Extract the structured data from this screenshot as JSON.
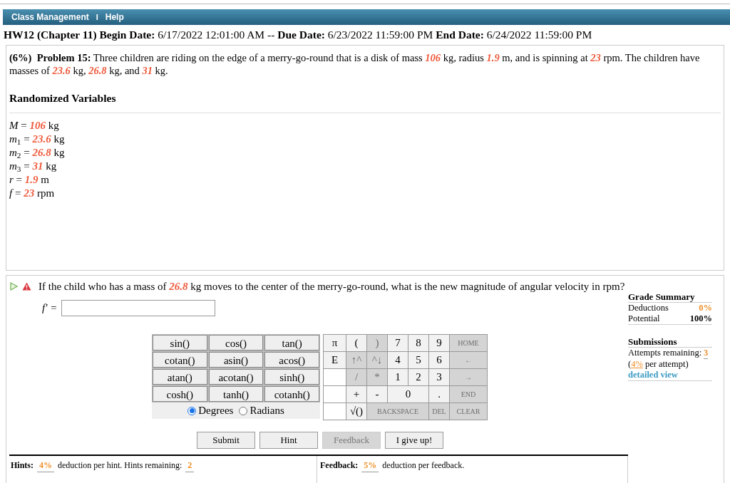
{
  "menu": [
    "Class Management",
    "I",
    "Help"
  ],
  "assignment_header": "**HW12 (Chapter 11) Begin Date:** 6/17/2022 12:01:00 AM -- **Due Date:** 6/23/2022 11:59:00 PM **End Date:** 6/24/2022 11:59:00 PM",
  "problem": {
    "text": "**(6%)  Problem 15:**   Three children are riding on the edge of a merry-go-round that is a disk of mass *106* kg, radius *1.9* m, and is spinning at *23* rpm. The children have masses of *23.6* kg, *26.8* kg, and *31* kg.",
    "variables_title": "Randomized Variables",
    "variables": [
      "*M* = **106** kg",
      "*m*$_{1}$ = **23.6** kg",
      "*m*$_{2}$ = **26.8** kg",
      "*m*$_{3}$ = **31** kg",
      "*r* = **1.9** m",
      "*f* = **23** rpm"
    ]
  },
  "question": {
    "text": "If the child who has a mass of *26.8* kg moves to the center of the merry-go-round, what is the new magnitude of angular velocity in rpm?",
    "answer_label": "f' =",
    "functions": [
      "sin()",
      "cos()",
      "tan()",
      "cotan()",
      "asin()",
      "acos()",
      "atan()",
      "acotan()",
      "sinh()",
      "cosh()",
      "tanh()",
      "cotanh()"
    ],
    "angle_modes": [
      {
        "label": "Degrees",
        "selected": true
      },
      {
        "label": "Radians",
        "selected": false
      }
    ],
    "keypad": [
      {
        "kind": "key",
        "label": "π",
        "disabled": false
      },
      {
        "kind": "key",
        "label": "(",
        "disabled": false
      },
      {
        "kind": "key",
        "label": ")",
        "disabled": true
      },
      {
        "kind": "key",
        "label": "7",
        "disabled": false
      },
      {
        "kind": "key",
        "label": "8",
        "disabled": false
      },
      {
        "kind": "key",
        "label": "9",
        "disabled": false
      },
      {
        "kind": "small",
        "label": "HOME",
        "disabled": true
      },
      {
        "kind": "key",
        "label": "E",
        "disabled": false
      },
      {
        "kind": "key",
        "label": "↑^",
        "disabled": true
      },
      {
        "kind": "key",
        "label": "^↓",
        "disabled": true
      },
      {
        "kind": "key",
        "label": "4",
        "disabled": false
      },
      {
        "kind": "key",
        "label": "5",
        "disabled": false
      },
      {
        "kind": "key",
        "label": "6",
        "disabled": false
      },
      {
        "kind": "small",
        "label": "←",
        "disabled": true
      },
      {
        "kind": "blank"
      },
      {
        "kind": "key",
        "label": "/",
        "disabled": true
      },
      {
        "kind": "key",
        "label": "*",
        "disabled": true
      },
      {
        "kind": "key",
        "label": "1",
        "disabled": false
      },
      {
        "kind": "key",
        "label": "2",
        "disabled": false
      },
      {
        "kind": "key",
        "label": "3",
        "disabled": false
      },
      {
        "kind": "small",
        "label": "→",
        "disabled": true
      },
      {
        "kind": "blank"
      },
      {
        "kind": "key",
        "label": "+",
        "disabled": false
      },
      {
        "kind": "key",
        "label": "-",
        "disabled": false
      },
      {
        "kind": "double",
        "label": "0",
        "disabled": false
      },
      {
        "kind": "key",
        "label": ".",
        "disabled": false
      },
      {
        "kind": "small",
        "label": "END",
        "disabled": true
      },
      {
        "kind": "blank"
      },
      {
        "kind": "key",
        "label": "√()",
        "disabled": false
      },
      {
        "kind": "triple",
        "label": "BACKSPACE",
        "disabled": true
      },
      {
        "kind": "small",
        "label": "DEL",
        "disabled": true
      },
      {
        "kind": "small",
        "label": "CLEAR",
        "disabled": true
      }
    ],
    "buttons": [
      {
        "label": "Submit",
        "disabled": false
      },
      {
        "label": "Hint",
        "disabled": false
      },
      {
        "label": "Feedback",
        "disabled": true
      },
      {
        "label": "I give up!",
        "disabled": false
      }
    ],
    "grade_summary": {
      "title": "Grade Summary",
      "deductions_label": "Deductions",
      "deductions": "0%",
      "potential_label": "Potential",
      "potential": "100%"
    },
    "submissions": {
      "title": "Submissions",
      "attempts_label": "Attempts remaining:",
      "attempts": "3",
      "per_attempt": "(**4%** per attempt)",
      "link": "detailed view"
    },
    "hints": {
      "label": "Hints:",
      "deduction": "4%",
      "text": "deduction per hint. Hints remaining:",
      "remaining": "2"
    },
    "feedback": {
      "label": "Feedback:",
      "deduction": "5%",
      "text": "deduction per feedback."
    }
  }
}
